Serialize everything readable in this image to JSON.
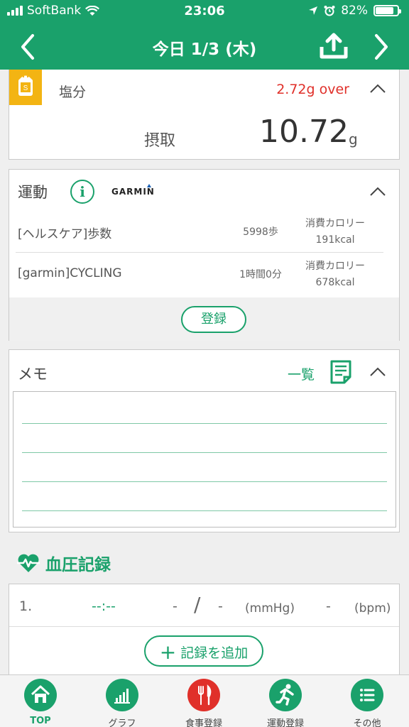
{
  "status": {
    "carrier": "SoftBank",
    "time": "23:06",
    "battery": "82%",
    "battery_level": 0.82
  },
  "header": {
    "title": "今日 1/3 (木)"
  },
  "salt": {
    "label": "塩分",
    "icon_letter": "S",
    "over": "2.72g over",
    "intake_label": "摂取",
    "value": "10.72",
    "unit": "g"
  },
  "exercise": {
    "title": "運動",
    "info_glyph": "i",
    "brand": "GARMIN",
    "rows": [
      {
        "name": "[ヘルスケア]歩数",
        "amount": "5998歩",
        "cal_label": "消費カロリー",
        "cal_value": "191kcal"
      },
      {
        "name": "[garmin]CYCLING",
        "amount": "1時間0分",
        "cal_label": "消費カロリー",
        "cal_value": "678kcal"
      }
    ],
    "register": "登録"
  },
  "memo": {
    "title": "メモ",
    "list_label": "一覧"
  },
  "bp": {
    "title": "血圧記録",
    "row": {
      "index": "1.",
      "time": "--:--",
      "sys": "-",
      "slash": "/",
      "dia": "-",
      "unit": "(mmHg)",
      "pulse": "-",
      "pulse_unit": "(bpm)"
    },
    "add": "記録を追加",
    "add_glyph": "+"
  },
  "tabs": [
    {
      "label": "TOP",
      "icon": "home-icon",
      "color": "#1aa16b"
    },
    {
      "label": "グラフ",
      "icon": "chart-icon",
      "color": "#1aa16b"
    },
    {
      "label": "食事登録",
      "icon": "fork-knife-icon",
      "color": "#e0302a"
    },
    {
      "label": "運動登録",
      "icon": "runner-icon",
      "color": "#1aa16b"
    },
    {
      "label": "その他",
      "icon": "list-icon",
      "color": "#1aa16b"
    }
  ],
  "colors": {
    "brand": "#1aa16b",
    "over": "#e0302a",
    "salt": "#f3b413"
  }
}
